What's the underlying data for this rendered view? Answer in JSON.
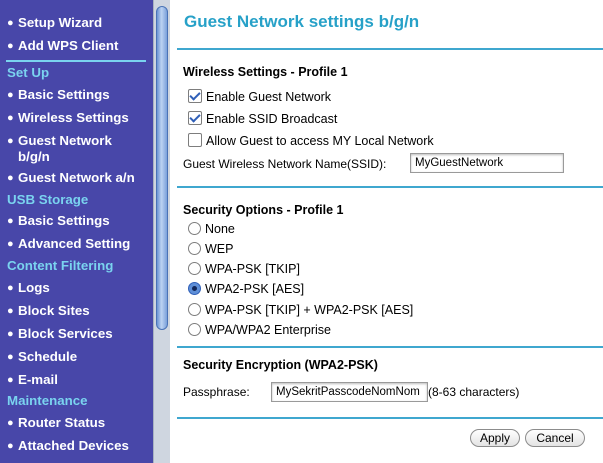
{
  "sidebar": {
    "items": [
      {
        "label": "Setup Wizard"
      },
      {
        "label": "Add WPS Client"
      },
      {
        "label": "Set Up"
      },
      {
        "label": "Basic Settings"
      },
      {
        "label": "Wireless Settings"
      },
      {
        "label_line1": "Guest Network",
        "label_line2": "b/g/n"
      },
      {
        "label": "Guest Network a/n"
      },
      {
        "label": "USB Storage"
      },
      {
        "label": "Basic Settings"
      },
      {
        "label": "Advanced Setting"
      },
      {
        "label": "Content Filtering"
      },
      {
        "label": "Logs"
      },
      {
        "label": "Block Sites"
      },
      {
        "label": "Block Services"
      },
      {
        "label": "Schedule"
      },
      {
        "label": "E-mail"
      },
      {
        "label": "Maintenance"
      },
      {
        "label": "Router Status"
      },
      {
        "label": "Attached Devices"
      }
    ],
    "bullet": "●"
  },
  "page": {
    "title": "Guest Network settings b/g/n"
  },
  "wireless": {
    "title": "Wireless Settings - Profile 1",
    "enable_guest": {
      "label": "Enable Guest Network",
      "checked": true
    },
    "enable_ssid": {
      "label": "Enable SSID Broadcast",
      "checked": true
    },
    "allow_local": {
      "label": "Allow Guest to access MY Local Network",
      "checked": false
    },
    "ssid_label": "Guest Wireless Network Name(SSID):",
    "ssid_value": "MyGuestNetwork"
  },
  "security": {
    "title": "Security Options - Profile 1",
    "options": [
      {
        "label": "None",
        "selected": false
      },
      {
        "label": "WEP",
        "selected": false
      },
      {
        "label": "WPA-PSK [TKIP]",
        "selected": false
      },
      {
        "label": "WPA2-PSK [AES]",
        "selected": true
      },
      {
        "label": "WPA-PSK [TKIP] + WPA2-PSK [AES]",
        "selected": false
      },
      {
        "label": "WPA/WPA2 Enterprise",
        "selected": false
      }
    ]
  },
  "encryption": {
    "title": "Security Encryption (WPA2-PSK)",
    "passphrase_label": "Passphrase:",
    "passphrase_value": "MySekritPasscodeNomNom",
    "passphrase_hint": "(8-63 characters)"
  },
  "actions": {
    "apply_label": "Apply",
    "cancel_label": "Cancel"
  },
  "colors": {
    "sidebar_bg": "#4847a9",
    "section_heading": "#7ad3ef",
    "title_accent": "#27a1c8"
  }
}
